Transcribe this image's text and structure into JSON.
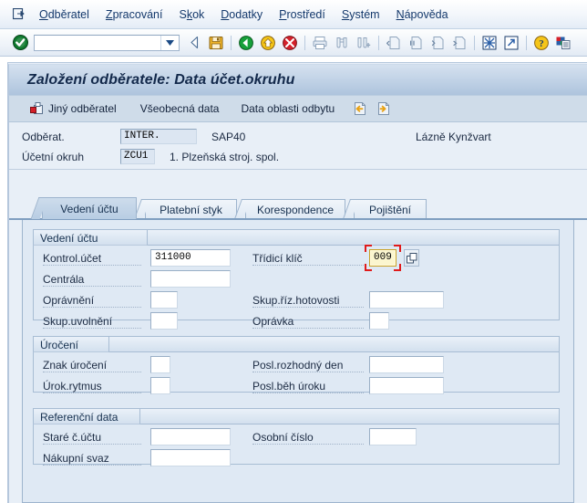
{
  "menu": {
    "system_icon": "sap-session-icon",
    "items": [
      {
        "label": "Odběratel",
        "accel_index": 0
      },
      {
        "label": "Zpracování",
        "accel_index": 0
      },
      {
        "label": "Skok",
        "accel_index": 1
      },
      {
        "label": "Dodatky",
        "accel_index": 0
      },
      {
        "label": "Prostředí",
        "accel_index": 0
      },
      {
        "label": "Systém",
        "accel_index": 0
      },
      {
        "label": "Nápověda",
        "accel_index": 0
      }
    ]
  },
  "toolbar": {
    "enter_icon": "green-check-enter-icon",
    "command_field_value": "",
    "command_field_placeholder": "",
    "dropdown_icon": "chevron-down-icon",
    "icons": [
      "back-arrow-icon",
      "save-disk-icon",
      "back-green-icon",
      "exit-yellow-icon",
      "cancel-red-icon",
      "print-icon",
      "find-icon",
      "find-next-icon",
      "first-page-icon",
      "previous-page-icon",
      "next-page-icon",
      "last-page-icon",
      "create-session-icon",
      "create-shortcut-icon",
      "help-icon",
      "customize-layout-icon"
    ]
  },
  "title": "Založení odběratele: Data účet.okruhu",
  "app_toolbar": {
    "buttons": [
      {
        "label": "Jiný odběratel",
        "icon": "other-customer-icon"
      },
      {
        "label": "Všeobecná data",
        "icon": ""
      },
      {
        "label": "Data oblasti odbytu",
        "icon": ""
      }
    ],
    "icons": [
      "previous-screen-icon",
      "next-screen-icon"
    ]
  },
  "header": {
    "rows": [
      {
        "label": "Odběrat.",
        "value": "INTER.",
        "code": "SAP40",
        "description": "Lázně Kynžvart"
      },
      {
        "label": "Účetní okruh",
        "value": "ZCU1",
        "code": "1. Plzeňská stroj. spol.",
        "description": ""
      }
    ]
  },
  "tabs": [
    {
      "label": "Vedení účtu",
      "active": true
    },
    {
      "label": "Platební styk",
      "active": false
    },
    {
      "label": "Korespondence",
      "active": false
    },
    {
      "label": "Pojištění",
      "active": false
    }
  ],
  "groups": [
    {
      "title": "Vedení účtu",
      "fields": [
        {
          "label": "Kontrol.účet",
          "value": "311000",
          "col": "left",
          "width": "wide",
          "row": 0
        },
        {
          "label": "Třídicí klíč",
          "value": "009",
          "col": "right",
          "width": "tiny",
          "row": 0,
          "focused": true,
          "match_code": true
        },
        {
          "label": "Centrála",
          "value": "",
          "col": "left",
          "width": "wide",
          "row": 1
        },
        {
          "label": "Oprávnění",
          "value": "",
          "col": "left",
          "width": "small",
          "row": 2
        },
        {
          "label": "Skup.říz.hotovosti",
          "value": "",
          "col": "right",
          "width": "medium",
          "row": 2
        },
        {
          "label": "Skup.uvolnění",
          "value": "",
          "col": "left",
          "width": "small",
          "row": 3
        },
        {
          "label": "Oprávka",
          "value": "",
          "col": "right",
          "width": "tiny",
          "row": 3
        }
      ]
    },
    {
      "title": "Úročení",
      "fields": [
        {
          "label": "Znak úročení",
          "value": "",
          "col": "left",
          "width": "tiny",
          "row": 0
        },
        {
          "label": "Posl.rozhodný den",
          "value": "",
          "col": "right",
          "width": "medium",
          "row": 0
        },
        {
          "label": "Úrok.rytmus",
          "value": "",
          "col": "left",
          "width": "tiny",
          "row": 1
        },
        {
          "label": "Posl.běh úroku",
          "value": "",
          "col": "right",
          "width": "medium",
          "row": 1
        }
      ]
    },
    {
      "title": "Referenční data",
      "fields": [
        {
          "label": "Staré č.účtu",
          "value": "",
          "col": "left",
          "width": "wide",
          "row": 0
        },
        {
          "label": "Osobní číslo",
          "value": "",
          "col": "right",
          "width": "small2",
          "row": 0
        },
        {
          "label": "Nákupní svaz",
          "value": "",
          "col": "left",
          "width": "wide",
          "row": 1
        }
      ]
    }
  ],
  "colors": {
    "accent": "#13386b",
    "title_text": "#13294b",
    "focus_border": "#c9a227",
    "focus_marker": "#e01b1b",
    "panel_bg": "#dfe9f4",
    "content_bg": "#e8eff7"
  }
}
